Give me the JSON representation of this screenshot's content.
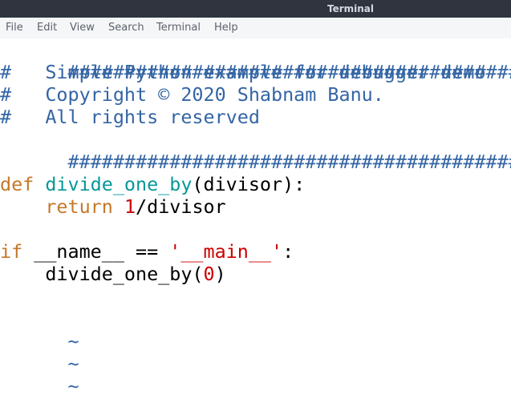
{
  "window": {
    "title": "Terminal"
  },
  "menu": {
    "items": [
      "File",
      "Edit",
      "View",
      "Search",
      "Terminal",
      "Help"
    ]
  },
  "editor": {
    "header_rule_top": "############################################",
    "comment_marker": "#",
    "comment_line_1": "   Simple Python example for debugger demo",
    "comment_line_2": "   Copyright © 2020 Shabnam Banu.",
    "comment_line_3": "   All rights reserved",
    "header_rule_bottom": "###########################################",
    "def_keyword": "def",
    "func_name": "divide_one_by",
    "def_params": "(divisor):",
    "return_indent": "    ",
    "return_keyword": "return",
    "return_number": "1",
    "return_rest": "/divisor",
    "if_keyword": "if",
    "if_condition": " __name__ == ",
    "main_string": "'__main__'",
    "if_colon": ":",
    "call_indent": "    ",
    "call_name": "divide_one_by(",
    "call_arg": "0",
    "call_close": ")",
    "empty_line_marker": "~"
  },
  "colors": {
    "titlebar_bg": "#2f343f",
    "menubar_bg": "#f5f6f7",
    "comment": "#3465a4",
    "keyword": "#c4792a",
    "function": "#06989a",
    "literal": "#cc0000"
  }
}
